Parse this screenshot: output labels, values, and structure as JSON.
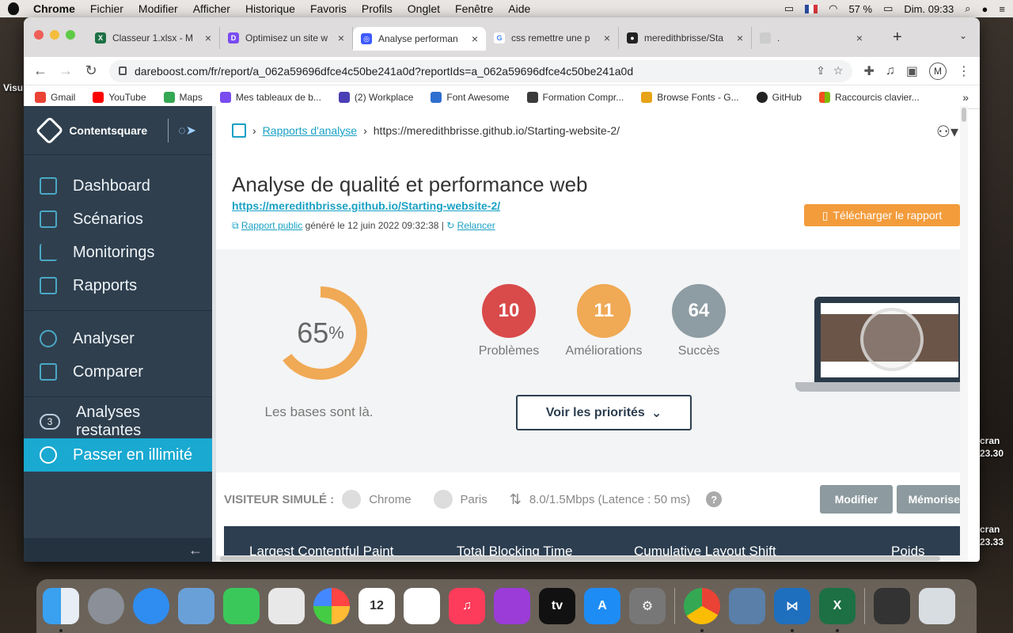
{
  "menubar": {
    "app": "Chrome",
    "items": [
      "Fichier",
      "Modifier",
      "Afficher",
      "Historique",
      "Favoris",
      "Profils",
      "Onglet",
      "Fenêtre",
      "Aide"
    ],
    "battery": "57 %",
    "clock": "Dim. 09:33"
  },
  "desktop": {
    "left_label": "Visu",
    "right_label_1_a": "cran",
    "right_label_1_b": "23.30",
    "right_label_2_a": "cran",
    "right_label_2_b": "23.33"
  },
  "tabs": [
    {
      "label": "Classeur 1.xlsx - M",
      "icon_color": "#1d7044",
      "icon": "X"
    },
    {
      "label": "Optimisez un site w",
      "icon_color": "#7a4cf0",
      "icon": "D"
    },
    {
      "label": "Analyse performan",
      "icon_color": "#3d5afe",
      "icon": "◎",
      "active": true
    },
    {
      "label": "css remettre une p",
      "icon_color": "#ffffff",
      "icon": "G"
    },
    {
      "label": "meredithbrisse/Sta",
      "icon_color": "#222222",
      "icon": "●"
    },
    {
      "label": ".",
      "icon_color": "#cccccc",
      "icon": ""
    }
  ],
  "toolbar": {
    "url": "dareboost.com/fr/report/a_062a59696dfce4c50be241a0d?reportIds=a_062a59696dfce4c50be241a0d",
    "profile": "M"
  },
  "bookmarks": [
    {
      "label": "Gmail",
      "color": "#ea4335"
    },
    {
      "label": "YouTube",
      "color": "#ff0000"
    },
    {
      "label": "Maps",
      "color": "#34a853"
    },
    {
      "label": "Mes tableaux de b...",
      "color": "#7a4cf0"
    },
    {
      "label": "(2) Workplace",
      "color": "#4b3fb5"
    },
    {
      "label": "Font Awesome",
      "color": "#2f6fcf"
    },
    {
      "label": "Formation Compr...",
      "color": "#3a3a3a"
    },
    {
      "label": "Browse Fonts - G...",
      "color": "#e8a317"
    },
    {
      "label": "GitHub",
      "color": "#222222"
    },
    {
      "label": "Raccourcis clavier...",
      "color": "#f25022"
    }
  ],
  "sidebar": {
    "brand": "Contentsquare",
    "section1": [
      "Dashboard",
      "Scénarios",
      "Monitorings",
      "Rapports"
    ],
    "section2": [
      "Analyser",
      "Comparer"
    ],
    "remaining_count": "3",
    "remaining_label": "Analyses restantes",
    "cta": "Passer en illimité",
    "collapse": "←"
  },
  "breadcrumb": {
    "link": "Rapports d'analyse",
    "current": "https://meredithbrisse.github.io/Starting-website-2/"
  },
  "report": {
    "title": "Analyse de qualité et performance web",
    "url": "https://meredithbrisse.github.io/Starting-website-2/",
    "public_link": "Rapport public",
    "generated": "généré le 12 juin 2022 09:32:38 |",
    "rerun": "Relancer",
    "download": "Télécharger le rapport"
  },
  "score": {
    "value": 65,
    "value_text": "65",
    "unit": "%",
    "caption": "Les bases sont là.",
    "color": "#f0a955"
  },
  "stats": [
    {
      "value": "10",
      "label": "Problèmes",
      "color": "#d94a4a"
    },
    {
      "value": "11",
      "label": "Améliorations",
      "color": "#f0a955"
    },
    {
      "value": "64",
      "label": "Succès",
      "color": "#8e9ca3"
    }
  ],
  "priorities_button": "Voir les priorités",
  "visitor": {
    "label": "VISITEUR SIMULÉ :",
    "browser": "Chrome",
    "location": "Paris",
    "network": "8.0/1.5Mbps (Latence : 50 ms)",
    "help": "?",
    "modify": "Modifier",
    "memorize": "Mémoriser"
  },
  "metrics": [
    "Largest Contentful Paint",
    "Total Blocking Time",
    "Cumulative Layout Shift",
    "Poids"
  ]
}
